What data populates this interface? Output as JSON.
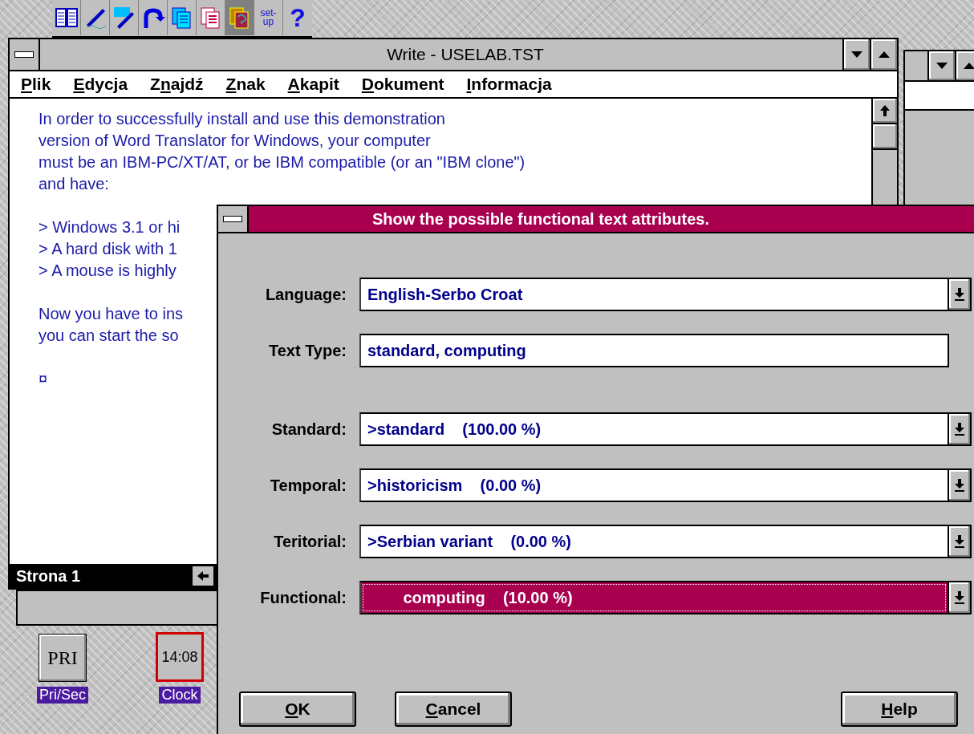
{
  "toolbar": {
    "buttons": [
      {
        "kind": "book",
        "pressed": false
      },
      {
        "kind": "pen",
        "pressed": false
      },
      {
        "kind": "write",
        "pressed": false
      },
      {
        "kind": "arrow",
        "pressed": false
      },
      {
        "kind": "pages",
        "pressed": false
      },
      {
        "kind": "redpages",
        "pressed": false
      },
      {
        "kind": "query",
        "pressed": true
      }
    ],
    "setup": [
      "set-",
      "up"
    ],
    "help": "?"
  },
  "write_window": {
    "title": "Write - USELAB.TST",
    "menu": [
      {
        "key": "P",
        "post": "lik"
      },
      {
        "key": "E",
        "post": "dycja"
      },
      {
        "pre": "Z",
        "key": "n",
        "post": "ajdź"
      },
      {
        "key": "Z",
        "post": "nak"
      },
      {
        "key": "A",
        "post": "kapit"
      },
      {
        "key": "D",
        "post": "okument"
      },
      {
        "key": "I",
        "post": "nformacja"
      }
    ],
    "paragraphs": [
      [
        "In order to successfully install and use this demonstration",
        "version of Word Translator for Windows, your computer",
        "must be an IBM-PC/XT/AT, or be IBM compatible (or an \"IBM clone\")",
        "and have:"
      ],
      [
        "> Windows 3.1 or hi",
        "> A hard disk with 1",
        "> A mouse is highly"
      ],
      [
        "Now you have to ins",
        "you can start the so"
      ],
      [
        "¤"
      ]
    ],
    "status": "Strona 1"
  },
  "desktop_icons": [
    {
      "kind": "pri",
      "face": "PRI",
      "label": "Pri/Sec"
    },
    {
      "kind": "clock",
      "face": "14:08",
      "label": "Clock"
    }
  ],
  "dialog": {
    "title": "Show the possible functional text attributes.",
    "groups": [
      [
        {
          "label": "Language:",
          "value": "English-Serbo Croat",
          "kind": "dropdown",
          "selected": false
        },
        {
          "label": "Text Type:",
          "value": "standard, computing",
          "kind": "text",
          "selected": false
        }
      ],
      [
        {
          "label": "Standard:",
          "value": ">standard    (100.00 %)",
          "kind": "dropdown",
          "selected": false
        },
        {
          "label": "Temporal:",
          "value": ">historicism    (0.00 %)",
          "kind": "dropdown",
          "selected": false
        },
        {
          "label": "Teritorial:",
          "value": ">Serbian variant    (0.00 %)",
          "kind": "dropdown",
          "selected": false
        },
        {
          "label": "Functional:",
          "value": "        computing    (10.00 %)",
          "kind": "dropdown",
          "selected": true
        }
      ]
    ],
    "buttons": [
      {
        "key": "O",
        "post": "K"
      },
      {
        "key": "C",
        "post": "ancel"
      },
      {
        "key": "H",
        "post": "elp"
      }
    ]
  }
}
